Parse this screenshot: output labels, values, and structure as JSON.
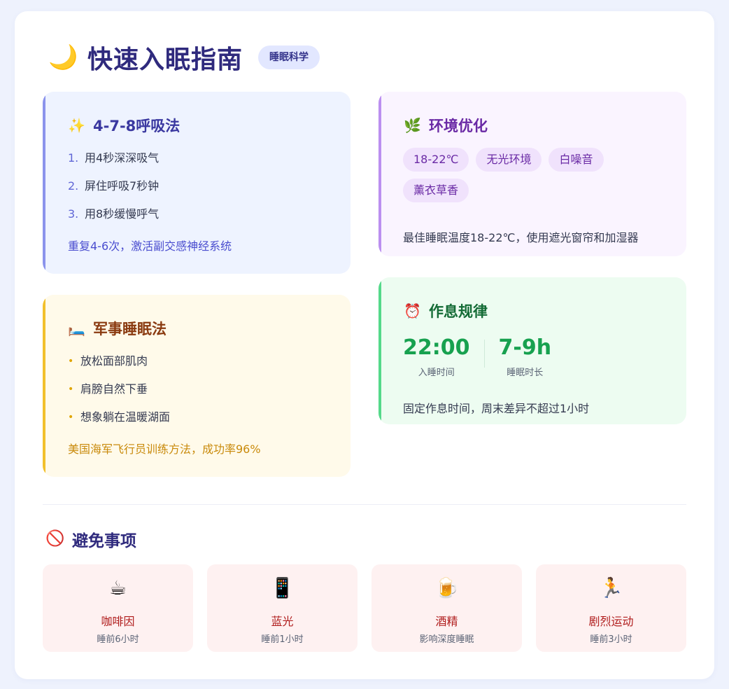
{
  "header": {
    "title": "快速入眠指南",
    "badge": "睡眠科学",
    "icon": "moon-icon"
  },
  "breathing": {
    "title": "4-7-8呼吸法",
    "icon": "sparkles-icon",
    "steps": [
      {
        "num": "1.",
        "text": "用4秒深深吸气"
      },
      {
        "num": "2.",
        "text": "屏住呼吸7秒钟"
      },
      {
        "num": "3.",
        "text": "用8秒缓慢呼气"
      }
    ],
    "note": "重复4-6次，激活副交感神经系统",
    "accent": "#8b93ec"
  },
  "environment": {
    "title": "环境优化",
    "icon": "herb-icon",
    "tags": [
      "18-22℃",
      "无光环境",
      "白噪音",
      "薰衣草香"
    ],
    "desc": "最佳睡眠温度18-22℃，使用遮光窗帘和加湿器",
    "accent": "#bb8ff0"
  },
  "military": {
    "title": "军事睡眠法",
    "icon": "bed-icon",
    "steps": [
      "放松面部肌肉",
      "肩膀自然下垂",
      "想象躺在温暖湖面"
    ],
    "bullet": "•",
    "note": "美国海军飞行员训练方法，成功率96%",
    "accent": "#f2c02c"
  },
  "schedule": {
    "title": "作息规律",
    "icon": "alarm-clock-icon",
    "stats": [
      {
        "value": "22:00",
        "label": "入睡时间"
      },
      {
        "value": "7-9h",
        "label": "睡眠时长"
      }
    ],
    "desc": "固定作息时间，周末差异不超过1小时",
    "accent": "#55d98a"
  },
  "avoid": {
    "title": "避免事项",
    "icon": "prohibited-icon",
    "items": [
      {
        "name": "咖啡因",
        "sub": "睡前6小时",
        "icon": "coffee-icon"
      },
      {
        "name": "蓝光",
        "sub": "睡前1小时",
        "icon": "phone-icon"
      },
      {
        "name": "酒精",
        "sub": "影响深度睡眠",
        "icon": "beer-icon"
      },
      {
        "name": "剧烈运动",
        "sub": "睡前3小时",
        "icon": "running-icon"
      }
    ]
  }
}
